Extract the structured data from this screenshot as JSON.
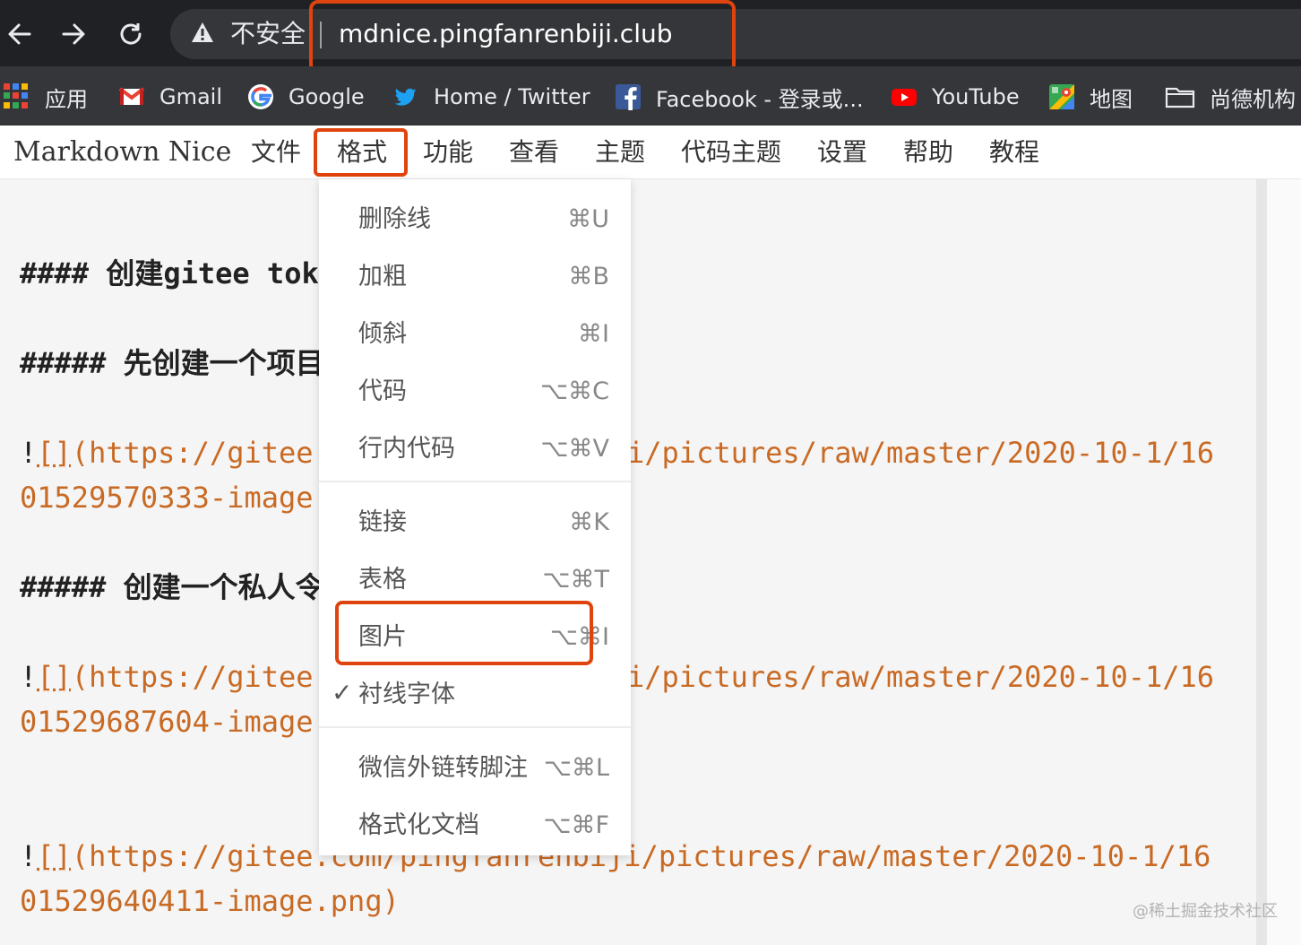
{
  "browser": {
    "back_icon": "arrow-left-icon",
    "forward_icon": "arrow-right-icon",
    "reload_icon": "reload-icon",
    "security_label": "不安全",
    "url": "mdnice.pingfanrenbiji.club"
  },
  "bookmarks": [
    {
      "label": "应用",
      "icon": "apps-grid-icon"
    },
    {
      "label": "Gmail",
      "icon": "gmail-icon"
    },
    {
      "label": "Google",
      "icon": "google-icon"
    },
    {
      "label": "Home / Twitter",
      "icon": "twitter-icon"
    },
    {
      "label": "Facebook - 登录或...",
      "icon": "facebook-icon"
    },
    {
      "label": "YouTube",
      "icon": "youtube-icon"
    },
    {
      "label": "地图",
      "icon": "maps-icon"
    },
    {
      "label": "尚德机构",
      "icon": "folder-icon"
    }
  ],
  "app": {
    "brand": "Markdown Nice",
    "menu": [
      "文件",
      "格式",
      "功能",
      "查看",
      "主题",
      "代码主题",
      "设置",
      "帮助",
      "教程"
    ],
    "active_menu": "格式"
  },
  "editor": {
    "h4": "#### 创建gitee tok",
    "h5_1": "##### 先创建一个项目",
    "img1_left_1": "(https://gitee.",
    "img1_right_1": "i/pictures/raw/master/2020-10-1/16",
    "img1_line2": "01529570333-image.",
    "h5_2": "##### 创建一个私人令",
    "img2_left_1": "(https://gitee.",
    "img2_right_1": "i/pictures/raw/master/2020-10-1/16",
    "img2_line2": "01529687604-image.",
    "img3_left_1": "(https://gitee.com/pingfanrenbiji/pictures/raw/master/2020-10-1/16",
    "img3_line2": "01529640411-image.png)",
    "bang": "!",
    "brackets": "[]"
  },
  "format_menu": {
    "group1": [
      {
        "label": "删除线",
        "shortcut": "⌘U"
      },
      {
        "label": "加粗",
        "shortcut": "⌘B"
      },
      {
        "label": "倾斜",
        "shortcut": "⌘I"
      },
      {
        "label": "代码",
        "shortcut": "⌥⌘C"
      },
      {
        "label": "行内代码",
        "shortcut": "⌥⌘V"
      }
    ],
    "group2": [
      {
        "label": "链接",
        "shortcut": "⌘K"
      },
      {
        "label": "表格",
        "shortcut": "⌥⌘T"
      },
      {
        "label": "图片",
        "shortcut": "⌥⌘I"
      },
      {
        "label": "衬线字体",
        "shortcut": "",
        "checked": true,
        "check_mark": "✓"
      }
    ],
    "group3": [
      {
        "label": "微信外链转脚注",
        "shortcut": "⌥⌘L"
      },
      {
        "label": "格式化文档",
        "shortcut": "⌥⌘F"
      }
    ]
  },
  "watermark": "@稀土掘金技术社区",
  "colors": {
    "highlight": "#e0440e",
    "link": "#c96a24",
    "browser_bg": "#202124"
  }
}
